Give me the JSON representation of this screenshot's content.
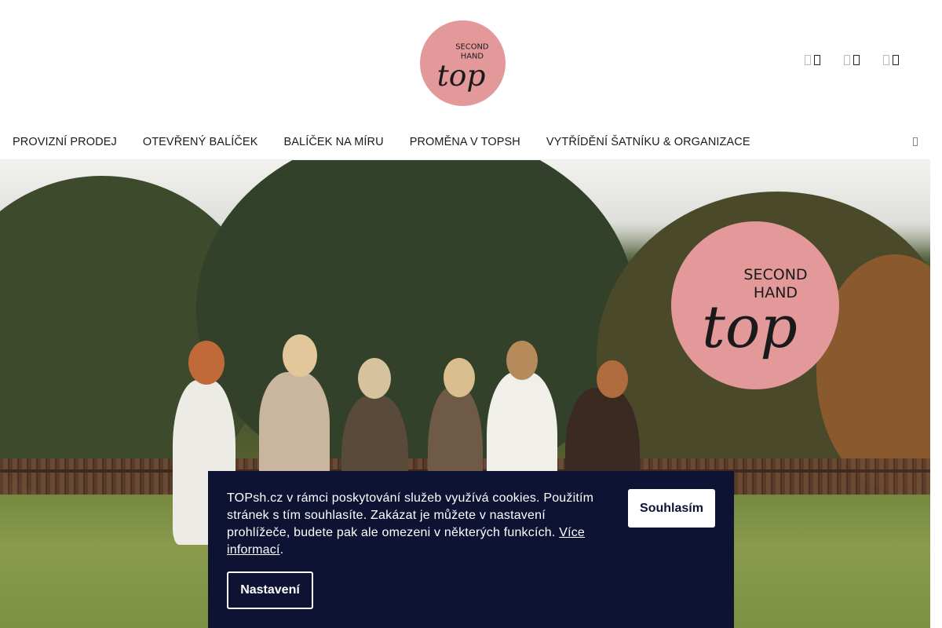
{
  "brand": {
    "logo_line1": "SECOND",
    "logo_line2": "HAND",
    "logo_word": "top",
    "logo_color": "#e3989a"
  },
  "header": {
    "icons": [
      "search-icon",
      "user-icon",
      "cart-icon"
    ]
  },
  "nav": {
    "items": [
      {
        "label": "PROVIZNÍ PRODEJ"
      },
      {
        "label": "OTEVŘENÝ BALÍČEK"
      },
      {
        "label": "BALÍČEK NA MÍRU"
      },
      {
        "label": "PROMĚNA V TOPSH"
      },
      {
        "label": "VYTŘÍDĚNÍ ŠATNÍKU & ORGANIZACE"
      }
    ],
    "more_icon": "chevron-icon"
  },
  "cookie": {
    "text": "TOPsh.cz v rámci poskytování služeb využívá cookies. Použitím stránek s tím souhlasíte. Zakázat je můžete v nastavení prohlížeče, budete pak ale omezeni v některých funkcích.",
    "link_text": "Více informací",
    "link_suffix": ".",
    "accept_label": "Souhlasím",
    "settings_label": "Nastavení",
    "background": "#0e1233"
  }
}
